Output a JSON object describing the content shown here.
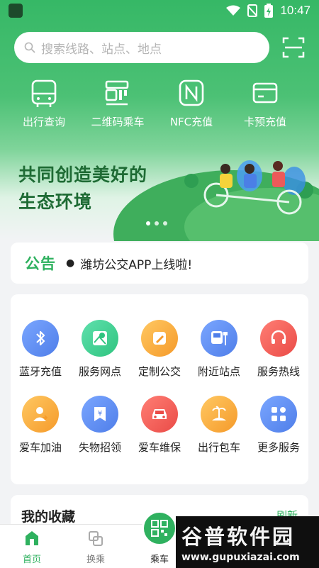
{
  "status_bar": {
    "time": "10:47"
  },
  "search": {
    "placeholder": "搜索线路、站点、地点"
  },
  "quick_actions": [
    {
      "label": "出行查询",
      "icon": "bus-icon"
    },
    {
      "label": "二维码乘车",
      "icon": "qr-code-icon"
    },
    {
      "label": "NFC充值",
      "icon": "nfc-icon"
    },
    {
      "label": "卡预充值",
      "icon": "card-icon"
    }
  ],
  "banner": {
    "line1": "共同创造美好的",
    "line2": "生态环境"
  },
  "notice": {
    "title": "公告",
    "text": "潍坊公交APP上线啦!"
  },
  "services": [
    {
      "label": "蓝牙充值",
      "icon": "bluetooth-icon",
      "color": "#5b8def"
    },
    {
      "label": "服务网点",
      "icon": "map-pin-icon",
      "color": "#3ccf95"
    },
    {
      "label": "定制公交",
      "icon": "pencil-icon",
      "color": "#fbad3d"
    },
    {
      "label": "附近站点",
      "icon": "bus-stop-icon",
      "color": "#5b8def"
    },
    {
      "label": "服务热线",
      "icon": "headset-icon",
      "color": "#f25c57"
    },
    {
      "label": "爱车加油",
      "icon": "fuel-user-icon",
      "color": "#fbad3d"
    },
    {
      "label": "失物招领",
      "icon": "lost-found-icon",
      "color": "#5b8def"
    },
    {
      "label": "爱车维保",
      "icon": "car-icon",
      "color": "#f25c57"
    },
    {
      "label": "出行包车",
      "icon": "beach-icon",
      "color": "#fbad3d"
    },
    {
      "label": "更多服务",
      "icon": "grid-icon",
      "color": "#5b8def"
    }
  ],
  "favorites": {
    "title": "我的收藏",
    "refresh": "刷新"
  },
  "tabs": {
    "home": "首页",
    "transfer": "换乘",
    "ride": "乘车"
  },
  "watermark": {
    "main": "谷普软件园",
    "sub": "www.gupuxiazai.com"
  },
  "colors": {
    "brand": "#2fb15f",
    "hero_top": "#36b866"
  }
}
